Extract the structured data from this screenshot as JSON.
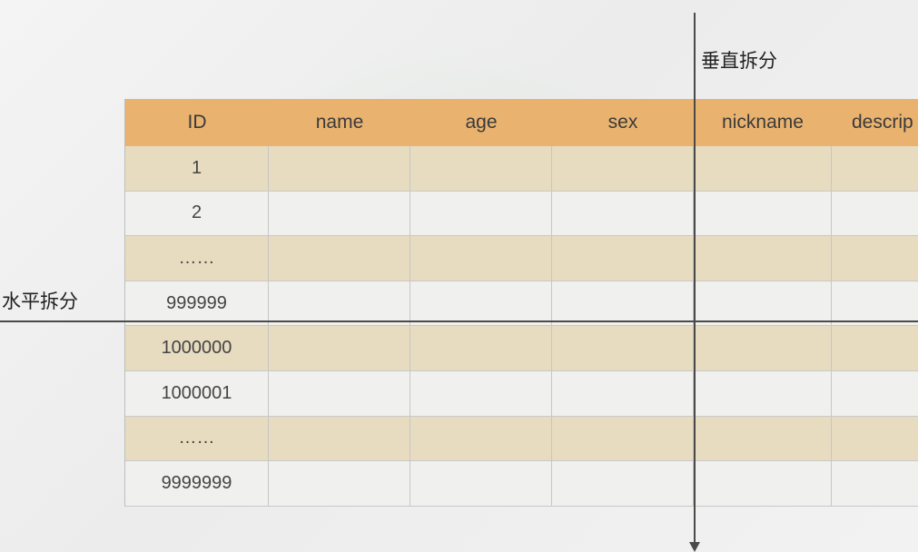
{
  "labels": {
    "vertical_split": "垂直拆分",
    "horizontal_split": "水平拆分"
  },
  "table": {
    "headers": [
      "ID",
      "name",
      "age",
      "sex",
      "nickname",
      "descrip"
    ],
    "id_rows": [
      "1",
      "2",
      "……",
      "999999",
      "1000000",
      "1000001",
      "……",
      "9999999"
    ]
  },
  "colors": {
    "header_bg": "#e9b26f",
    "odd_row_bg": "#e8dcc0",
    "even_row_bg": "#f0f0ee",
    "split_line": "#4a4a4a"
  }
}
